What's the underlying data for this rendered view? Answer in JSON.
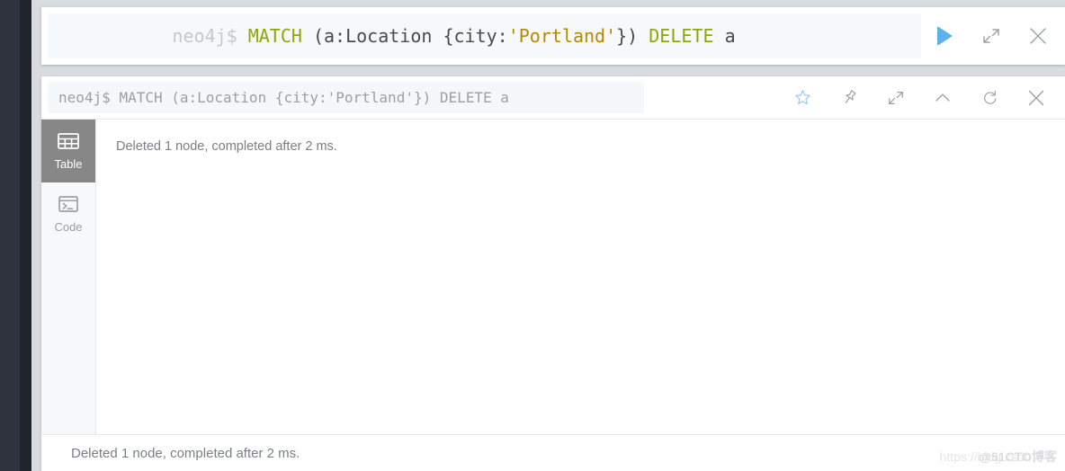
{
  "app": {
    "name": "neo4j-browser",
    "accent_blue": "#5cb3ec",
    "keyword_color": "#8fa60b",
    "string_color": "#b58900",
    "rail_color": "#2f333e"
  },
  "editor": {
    "prompt": "neo4j$",
    "query_tokens": [
      {
        "text": "MATCH ",
        "type": "keyword"
      },
      {
        "text": "(a:Location {city:",
        "type": "plain"
      },
      {
        "text": "'Portland'",
        "type": "string"
      },
      {
        "text": "}) ",
        "type": "plain"
      },
      {
        "text": "DELETE ",
        "type": "keyword"
      },
      {
        "text": "a",
        "type": "plain"
      }
    ],
    "query_plain": "MATCH (a:Location {city:'Portland'}) DELETE a",
    "actions": [
      {
        "name": "run-query-button",
        "icon": "play-icon",
        "label": "Run"
      },
      {
        "name": "expand-editor-button",
        "icon": "expand-icon",
        "label": "Expand"
      },
      {
        "name": "close-editor-button",
        "icon": "close-icon",
        "label": "Close"
      }
    ]
  },
  "frame": {
    "title_prompt": "neo4j$",
    "title_query": "MATCH (a:Location {city:'Portland'}) DELETE a",
    "icons": [
      {
        "name": "favorite-star-icon",
        "label": "Save as favorite"
      },
      {
        "name": "pin-icon",
        "label": "Pin"
      },
      {
        "name": "expand-icon",
        "label": "Fullscreen"
      },
      {
        "name": "chevron-up-icon",
        "label": "Collapse"
      },
      {
        "name": "refresh-icon",
        "label": "Rerun"
      },
      {
        "name": "close-icon",
        "label": "Close"
      }
    ],
    "view_tabs": [
      {
        "name": "tab-table",
        "label": "Table",
        "icon": "table-icon",
        "active": true
      },
      {
        "name": "tab-code",
        "label": "Code",
        "icon": "code-icon",
        "active": false
      }
    ],
    "result_message": "Deleted 1 node, completed after 2 ms.",
    "status_message": "Deleted 1 node, completed after 2 ms."
  },
  "watermark": {
    "url_text": "https://blog.csdn.",
    "brand_text": "@51CTO博客"
  }
}
